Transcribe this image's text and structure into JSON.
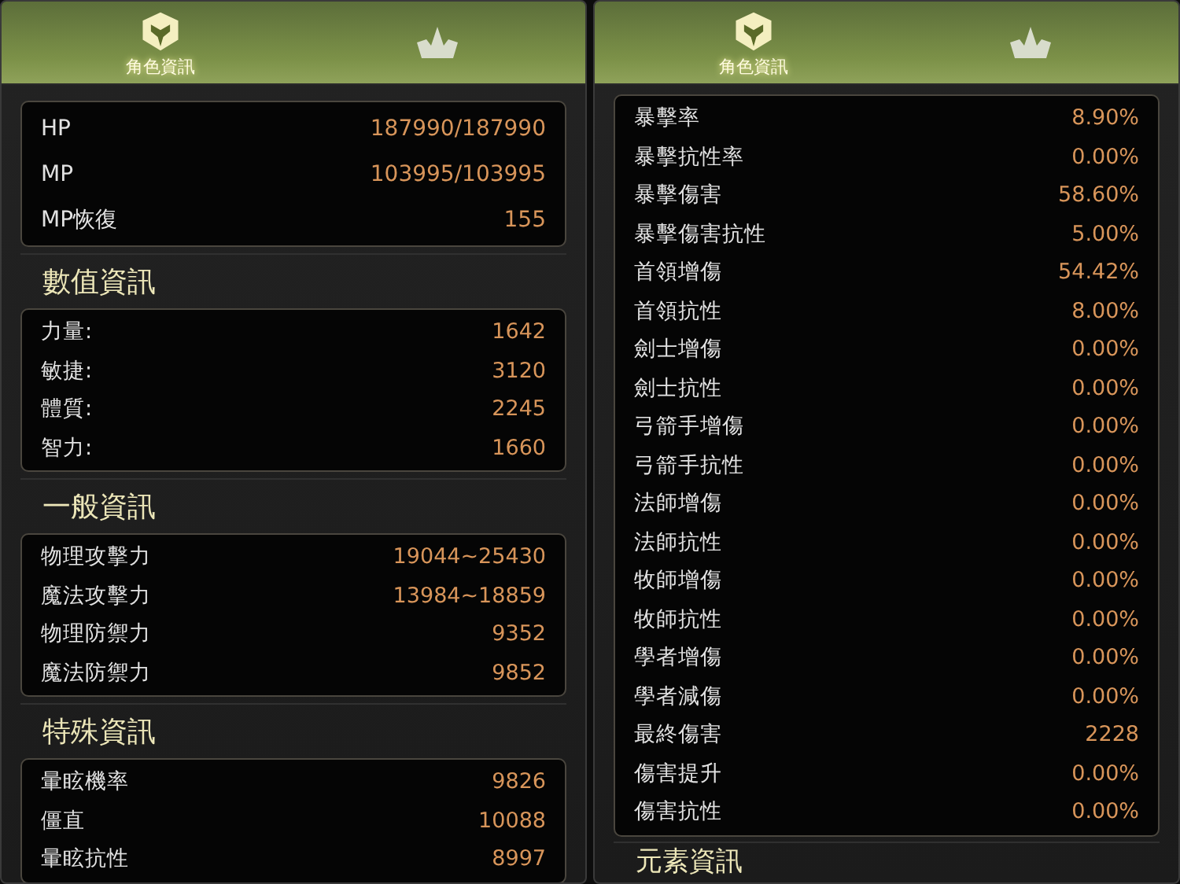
{
  "panels": [
    {
      "tabs": [
        {
          "kind": "helmet",
          "label": "角色資訊",
          "selected": true
        },
        {
          "kind": "crown",
          "selected": false
        }
      ],
      "sections": [
        {
          "kind": "vitals",
          "rows": [
            {
              "label": "HP",
              "value": "187990/187990"
            },
            {
              "label": "MP",
              "value": "103995/103995"
            },
            {
              "label": "MP恢復",
              "value": "155"
            }
          ]
        },
        {
          "title": "數值資訊",
          "rows": [
            {
              "label": "力量:",
              "value": "1642"
            },
            {
              "label": "敏捷:",
              "value": "3120"
            },
            {
              "label": "體質:",
              "value": "2245"
            },
            {
              "label": "智力:",
              "value": "1660"
            }
          ]
        },
        {
          "title": "一般資訊",
          "rows": [
            {
              "label": "物理攻擊力",
              "value": "19044~25430"
            },
            {
              "label": "魔法攻擊力",
              "value": "13984~18859"
            },
            {
              "label": "物理防禦力",
              "value": "9352"
            },
            {
              "label": "魔法防禦力",
              "value": "9852"
            }
          ]
        },
        {
          "title": "特殊資訊",
          "rows": [
            {
              "label": "暈眩機率",
              "value": "9826"
            },
            {
              "label": "僵直",
              "value": "10088"
            },
            {
              "label": "暈眩抗性",
              "value": "8997"
            }
          ]
        }
      ]
    },
    {
      "tabs": [
        {
          "kind": "helmet",
          "label": "角色資訊",
          "selected": true
        },
        {
          "kind": "crown",
          "selected": false
        }
      ],
      "sections": [
        {
          "rows": [
            {
              "label": "暴擊率",
              "value": "8.90%"
            },
            {
              "label": "暴擊抗性率",
              "value": "0.00%"
            },
            {
              "label": "暴擊傷害",
              "value": "58.60%"
            },
            {
              "label": "暴擊傷害抗性",
              "value": "5.00%"
            },
            {
              "label": "首領增傷",
              "value": "54.42%"
            },
            {
              "label": "首領抗性",
              "value": "8.00%"
            },
            {
              "label": "劍士增傷",
              "value": "0.00%"
            },
            {
              "label": "劍士抗性",
              "value": "0.00%"
            },
            {
              "label": "弓箭手增傷",
              "value": "0.00%"
            },
            {
              "label": "弓箭手抗性",
              "value": "0.00%"
            },
            {
              "label": "法師增傷",
              "value": "0.00%"
            },
            {
              "label": "法師抗性",
              "value": "0.00%"
            },
            {
              "label": "牧師增傷",
              "value": "0.00%"
            },
            {
              "label": "牧師抗性",
              "value": "0.00%"
            },
            {
              "label": "學者增傷",
              "value": "0.00%"
            },
            {
              "label": "學者減傷",
              "value": "0.00%"
            },
            {
              "label": "最終傷害",
              "value": "2228"
            },
            {
              "label": "傷害提升",
              "value": "0.00%"
            },
            {
              "label": "傷害抗性",
              "value": "0.00%"
            }
          ]
        },
        {
          "kind": "heading",
          "title": "元素資訊"
        }
      ]
    }
  ]
}
